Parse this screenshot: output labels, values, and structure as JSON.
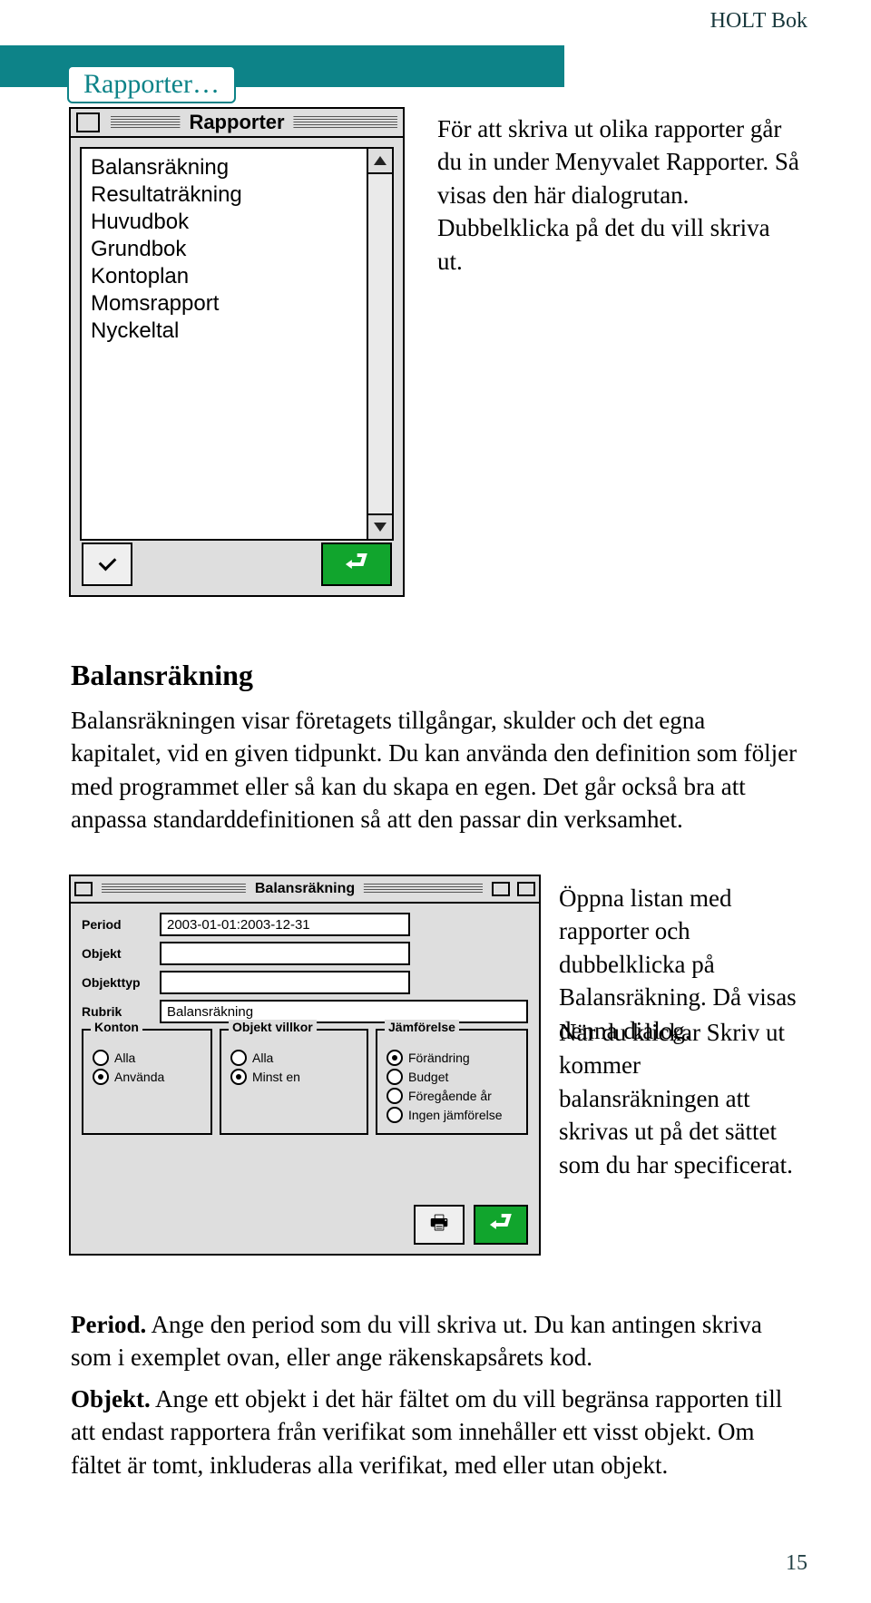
{
  "header": {
    "right": "HOLT Bok"
  },
  "section": {
    "title": "Rapporter…"
  },
  "win1": {
    "title": "Rapporter",
    "items": [
      "Balansräkning",
      "Resultaträkning",
      "Huvudbok",
      "Grundbok",
      "Kontoplan",
      "Momsrapport",
      "Nyckeltal"
    ]
  },
  "intro1": "För att skriva ut olika rapporter går du in under Menyvalet Rapporter. Så visas den här dialogrutan. Dubbelklicka på det du vill skriva ut.",
  "h2": "Balansräkning",
  "para1": "Balansräkningen visar företagets tillgångar, skulder och det egna kapitalet, vid en given tidpunkt. Du kan använda den definition som följer med programmet eller så kan du skapa en egen. Det går också bra att anpassa standarddefinitionen så att den passar din verksamhet.",
  "win2": {
    "title": "Balansräkning",
    "period_label": "Period",
    "period_value": "2003-01-01:2003-12-31",
    "objekt_label": "Objekt",
    "objekt_value": "",
    "objekttyp_label": "Objekttyp",
    "objekttyp_value": "",
    "rubrik_label": "Rubrik",
    "rubrik_value": "Balansräkning",
    "group_konton": {
      "legend": "Konton",
      "opts": [
        "Alla",
        "Använda"
      ],
      "checked": 1
    },
    "group_villkor": {
      "legend": "Objekt villkor",
      "opts": [
        "Alla",
        "Minst en"
      ],
      "checked": 1
    },
    "group_jamforelse": {
      "legend": "Jämförelse",
      "opts": [
        "Förändring",
        "Budget",
        "Föregående år",
        "Ingen jämförelse"
      ],
      "checked": 0
    }
  },
  "side2": "Öppna listan med rapporter och dubbelklicka på Balansräkning. Då visas denna dialog.",
  "side3": "När du klickar Skriv ut kommer balansräkningen att skrivas ut på det sättet som du har specificerat.",
  "para2a": "Period.",
  "para2b": " Ange den period som du vill skriva ut. Du kan antingen skriva som i exemplet ovan, eller ange räkenskapsårets kod.",
  "para3a": "Objekt.",
  "para3b": " Ange ett objekt i det här fältet om du vill begränsa rapporten till att endast rapportera från verifikat som innehåller ett visst objekt. Om fältet är tomt, inkluderas alla verifikat, med eller utan objekt.",
  "page_number": "15"
}
